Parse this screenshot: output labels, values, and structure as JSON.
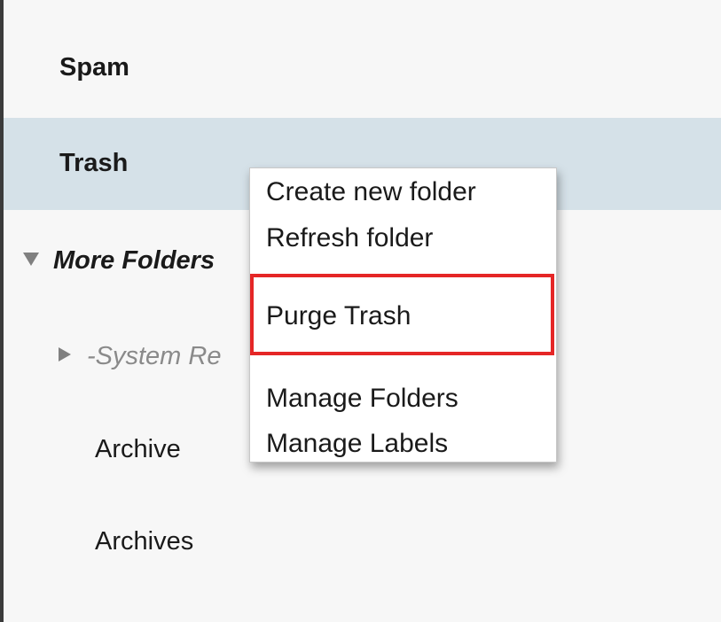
{
  "folders": {
    "spam": "Spam",
    "trash": "Trash",
    "more_folders": "More Folders",
    "system": "-System Re",
    "archive": "Archive",
    "archives": "Archives"
  },
  "context_menu": {
    "items": [
      "Create new folder",
      "Refresh folder",
      "Purge Trash",
      "Manage Folders",
      "Manage Labels"
    ],
    "highlighted_item": "Purge Trash"
  },
  "colors": {
    "selected_row": "#d5e1e8",
    "highlight_border": "#e52626",
    "background": "#f7f7f7"
  }
}
